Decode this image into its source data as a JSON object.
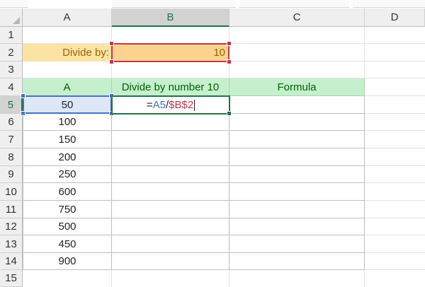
{
  "columns": [
    "A",
    "B",
    "C",
    "D"
  ],
  "active_column": "B",
  "rows": [
    "1",
    "2",
    "3",
    "4",
    "5",
    "6",
    "7",
    "8",
    "9",
    "10",
    "11",
    "12",
    "13",
    "14",
    "15"
  ],
  "active_row": "5",
  "divisor": {
    "label": "Divide by:",
    "value": "10"
  },
  "table": {
    "headers": [
      "A",
      "Divide by number 10",
      "Formula"
    ],
    "values": [
      "50",
      "100",
      "150",
      "200",
      "250",
      "600",
      "750",
      "500",
      "450",
      "900"
    ]
  },
  "formula": {
    "equals": "=",
    "ref": "A5",
    "op": "/",
    "abs": "$B$2"
  },
  "colors": {
    "header_fill": "#c6efce",
    "header_text": "#006100",
    "input_fill": "#fbd38f",
    "input_text": "#9c6500",
    "range_blue": "#4472c4",
    "range_red": "#c0394b",
    "active_green": "#217346"
  }
}
